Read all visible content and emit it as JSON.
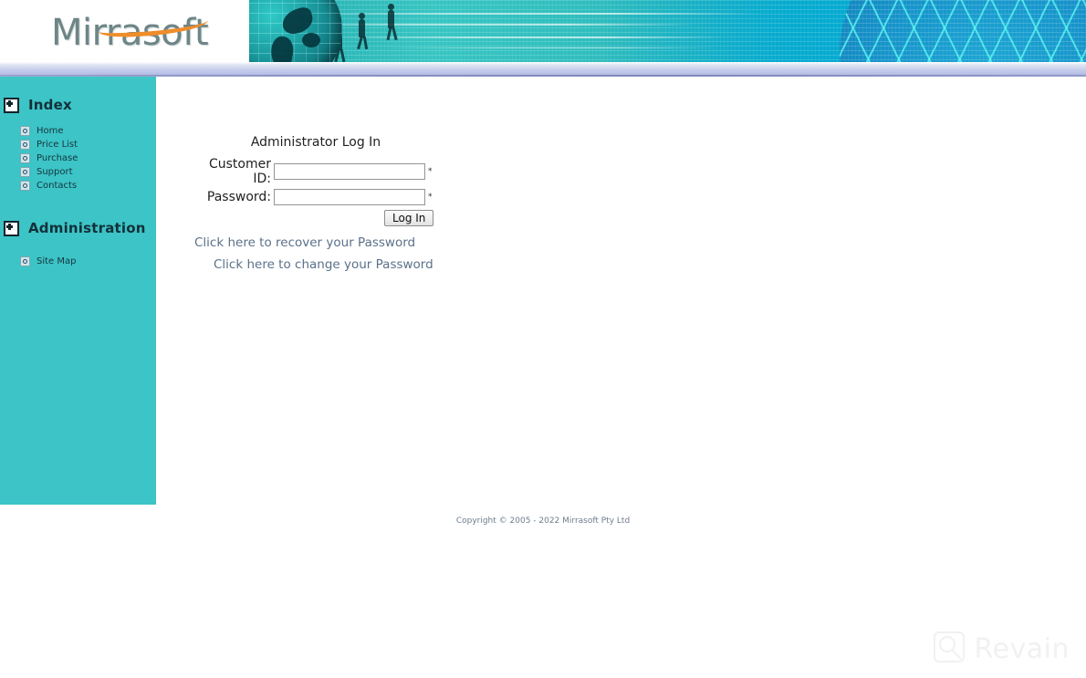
{
  "site": {
    "logo_text": "Mirrasoft",
    "logo_swoosh_color": "#ef8d2a",
    "logo_text_color": "#6e8586",
    "sidebar_color": "#3cc4c6",
    "banner_color": "#2fbdbd"
  },
  "sidebar": {
    "groups": [
      {
        "title": "Index",
        "expand_icon": "expand-plus-box-icon",
        "items": [
          {
            "label": "Home",
            "icon": "bullet-icon"
          },
          {
            "label": "Price List",
            "icon": "bullet-icon"
          },
          {
            "label": "Purchase",
            "icon": "bullet-icon"
          },
          {
            "label": "Support",
            "icon": "bullet-icon"
          },
          {
            "label": "Contacts",
            "icon": "bullet-icon"
          }
        ]
      },
      {
        "title": "Administration",
        "expand_icon": "expand-plus-box-icon",
        "items": [
          {
            "label": "Site Map",
            "icon": "bullet-icon"
          }
        ]
      }
    ]
  },
  "login": {
    "title": "Administrator Log In",
    "customer_id": {
      "label": "Customer ID:",
      "value": "",
      "placeholder": "",
      "required_mark": "*"
    },
    "password": {
      "label": "Password:",
      "value": "",
      "placeholder": "",
      "required_mark": "*"
    },
    "submit_label": "Log In",
    "recover_link": "Click here to recover your Password",
    "change_link": "Click here to change your Password",
    "link_color": "#5a7189"
  },
  "footer": {
    "copyright": "Copyright © 2005 - 2022 Mirrasoft Pty Ltd"
  },
  "watermark": {
    "text": "Revain",
    "logo_icon": "magnifier-square-icon"
  }
}
